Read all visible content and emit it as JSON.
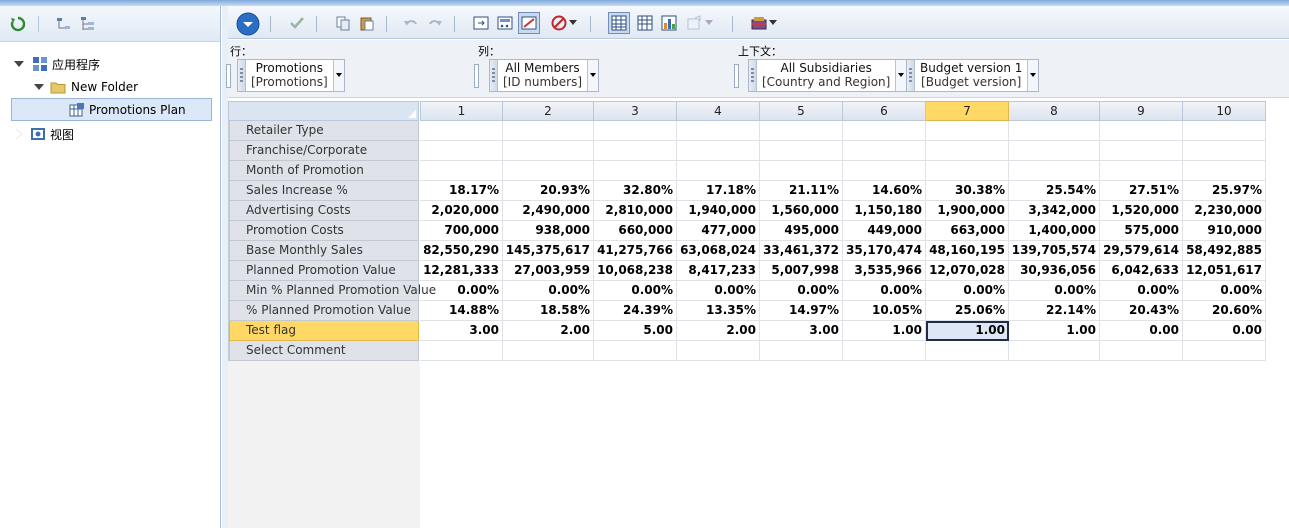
{
  "tree": {
    "items": [
      {
        "label": "应用程序",
        "level": 0,
        "expanded": true
      },
      {
        "label": "New Folder",
        "level": 1,
        "expanded": true
      },
      {
        "label": "Promotions Plan",
        "level": 2,
        "selected": true
      },
      {
        "label": "视图",
        "level": 0,
        "expanded": false
      }
    ]
  },
  "pov": {
    "row_label": "行：",
    "col_label": "列：",
    "context_label": "上下文：",
    "row_dim": {
      "line1": "Promotions",
      "line2": "[Promotions]"
    },
    "col_dim": {
      "line1": "All Members",
      "line2": "[ID numbers]"
    },
    "ctx1": {
      "line1": "All Subsidiaries",
      "line2": "[Country and Region]"
    },
    "ctx2": {
      "line1": "Budget version 1",
      "line2": "[Budget version]"
    }
  },
  "grid": {
    "columns": [
      "1",
      "2",
      "3",
      "4",
      "5",
      "6",
      "7",
      "8",
      "9",
      "10"
    ],
    "selected_column": 6,
    "selected_row": 10,
    "rows": [
      {
        "label": "Retailer Type",
        "values": [
          "",
          "",
          "",
          "",
          "",
          "",
          "",
          "",
          "",
          ""
        ]
      },
      {
        "label": "Franchise/Corporate",
        "values": [
          "",
          "",
          "",
          "",
          "",
          "",
          "",
          "",
          "",
          ""
        ]
      },
      {
        "label": "Month of Promotion",
        "values": [
          "",
          "",
          "",
          "",
          "",
          "",
          "",
          "",
          "",
          ""
        ]
      },
      {
        "label": "Sales Increase %",
        "values": [
          "18.17%",
          "20.93%",
          "32.80%",
          "17.18%",
          "21.11%",
          "14.60%",
          "30.38%",
          "25.54%",
          "27.51%",
          "25.97%"
        ]
      },
      {
        "label": "Advertising Costs",
        "values": [
          "2,020,000",
          "2,490,000",
          "2,810,000",
          "1,940,000",
          "1,560,000",
          "1,150,180",
          "1,900,000",
          "3,342,000",
          "1,520,000",
          "2,230,000"
        ]
      },
      {
        "label": "Promotion Costs",
        "values": [
          "700,000",
          "938,000",
          "660,000",
          "477,000",
          "495,000",
          "449,000",
          "663,000",
          "1,400,000",
          "575,000",
          "910,000"
        ]
      },
      {
        "label": "Base Monthly Sales",
        "values": [
          "82,550,290",
          "145,375,617",
          "41,275,766",
          "63,068,024",
          "33,461,372",
          "35,170,474",
          "48,160,195",
          "139,705,574",
          "29,579,614",
          "58,492,885"
        ]
      },
      {
        "label": "Planned Promotion Value",
        "values": [
          "12,281,333",
          "27,003,959",
          "10,068,238",
          "8,417,233",
          "5,007,998",
          "3,535,966",
          "12,070,028",
          "30,936,056",
          "6,042,633",
          "12,051,617"
        ]
      },
      {
        "label": "Min % Planned Promotion Value",
        "values": [
          "0.00%",
          "0.00%",
          "0.00%",
          "0.00%",
          "0.00%",
          "0.00%",
          "0.00%",
          "0.00%",
          "0.00%",
          "0.00%"
        ]
      },
      {
        "label": "% Planned Promotion Value",
        "values": [
          "14.88%",
          "18.58%",
          "24.39%",
          "13.35%",
          "14.97%",
          "10.05%",
          "25.06%",
          "22.14%",
          "20.43%",
          "20.60%"
        ]
      },
      {
        "label": "Test flag",
        "values": [
          "3.00",
          "2.00",
          "5.00",
          "2.00",
          "3.00",
          "1.00",
          "1.00",
          "1.00",
          "0.00",
          "0.00"
        ]
      },
      {
        "label": "Select Comment",
        "values": [
          "",
          "",
          "",
          "",
          "",
          "",
          "",
          "",
          "",
          ""
        ]
      }
    ]
  },
  "colors": {
    "selection": "#ffd865",
    "header_bg": "#dfe3e9"
  }
}
